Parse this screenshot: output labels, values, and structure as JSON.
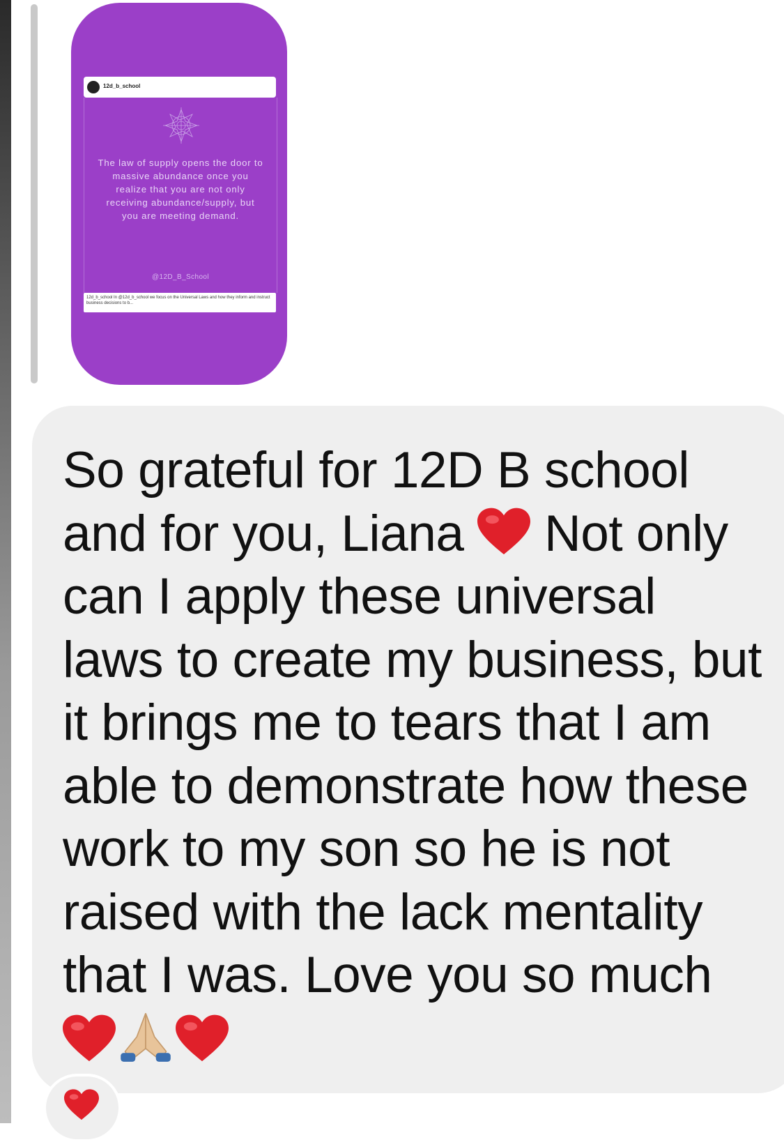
{
  "shared_post": {
    "handle": "12d_b_school",
    "quote": "The law of supply opens the door to massive abundance once you realize that you are not only receiving abundance/supply, but you are meeting demand.",
    "watermark": "@12D_B_School",
    "caption": "12d_b_school In @12d_b_school we focus on the Universal Laws and how they inform and instruct business decisions to b..."
  },
  "message": {
    "part1": "So grateful for 12D B school and for you, Liana ",
    "part2": " Not only can I apply these universal laws to create my business, but it brings me to tears that I am able to demonstrate how these work to my son so he is not raised with the lack mentality that I was. Love you so much "
  },
  "reaction": {
    "icon": "red-heart-icon"
  },
  "colors": {
    "story_purple": "#9b3fc8",
    "bubble_gray": "#efefef",
    "heart_red": "#e0202a"
  }
}
